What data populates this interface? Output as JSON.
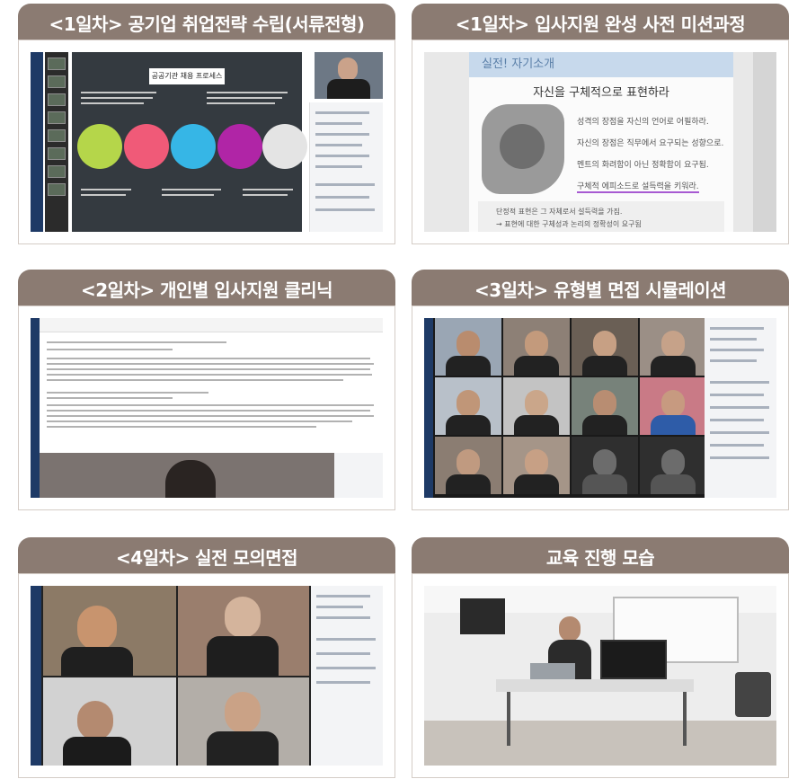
{
  "cards": [
    {
      "title": "<1일차> 공기업 취업전략 수립(서류전형)",
      "slide_title": "공공기관 채용 프로세스"
    },
    {
      "title": "<1일차> 입사지원 완성 사전 미션과정",
      "banner": "실전! 자기소개",
      "heading": "자신을 구체적으로 표현하라",
      "lines": [
        "성격의 장점을 자신의 언어로 어필하라.",
        "자신의 장점은 직무에서 요구되는 성향으로.",
        "멘트의 화려함이 아닌 정확함이 요구됨.",
        "구체적 에피소드로 설득력을 키워라."
      ],
      "box_lines": [
        "단정적 표현은 그 자체로서 설득력을 가짐.",
        "→ 표현에 대한 구체성과 논리의 정확성이 요구됨"
      ]
    },
    {
      "title": "<2일차> 개인별 입사지원 클리닉"
    },
    {
      "title": "<3일차> 유형별 면접 시뮬레이션"
    },
    {
      "title": "<4일차> 실전 모의면접"
    },
    {
      "title": "교육 진행 모습"
    }
  ]
}
